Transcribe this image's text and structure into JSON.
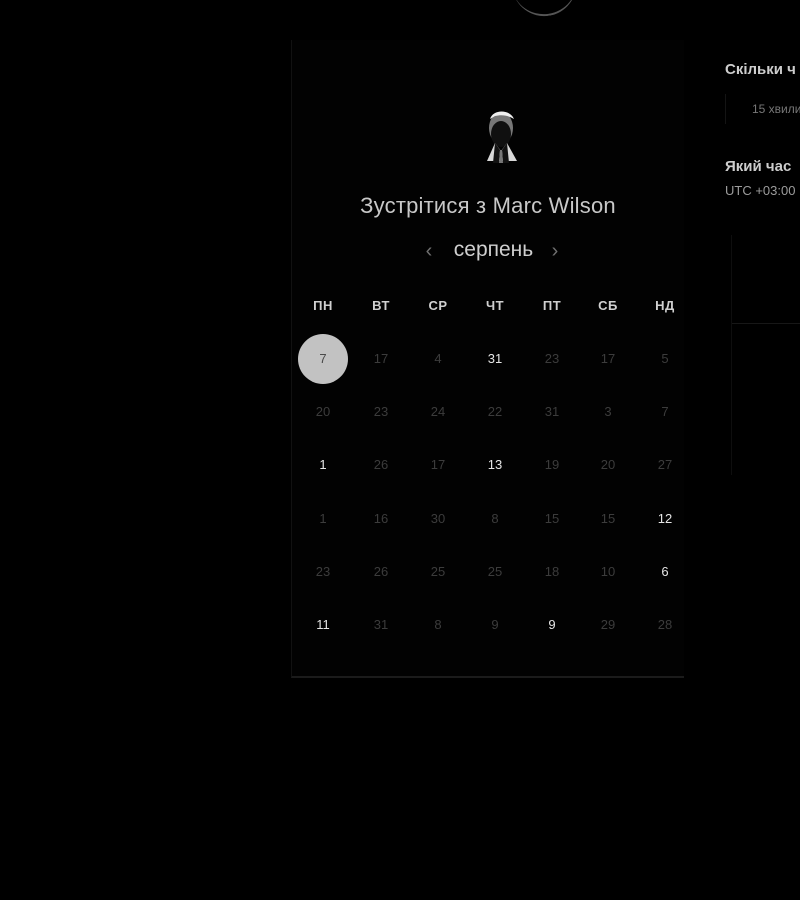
{
  "calendar": {
    "title_prefix": "Зустрітися з",
    "host_name": "Marc Wilson",
    "month": "серпень",
    "weekdays": [
      "ПН",
      "ВТ",
      "СР",
      "ЧТ",
      "ПТ",
      "СБ",
      "НД"
    ],
    "rows": [
      [
        {
          "label": "7",
          "state": "selected"
        },
        {
          "label": "17",
          "state": "muted"
        },
        {
          "label": "4",
          "state": "muted"
        },
        {
          "label": "31",
          "state": "available"
        },
        {
          "label": "23",
          "state": "muted"
        },
        {
          "label": "17",
          "state": "muted"
        },
        {
          "label": "5",
          "state": "muted"
        }
      ],
      [
        {
          "label": "20",
          "state": "muted"
        },
        {
          "label": "23",
          "state": "muted"
        },
        {
          "label": "24",
          "state": "muted"
        },
        {
          "label": "22",
          "state": "muted"
        },
        {
          "label": "31",
          "state": "muted"
        },
        {
          "label": "3",
          "state": "muted"
        },
        {
          "label": "7",
          "state": "muted"
        }
      ],
      [
        {
          "label": "1",
          "state": "available"
        },
        {
          "label": "26",
          "state": "muted"
        },
        {
          "label": "17",
          "state": "muted"
        },
        {
          "label": "13",
          "state": "available"
        },
        {
          "label": "19",
          "state": "muted"
        },
        {
          "label": "20",
          "state": "muted"
        },
        {
          "label": "27",
          "state": "muted"
        }
      ],
      [
        {
          "label": "1",
          "state": "muted"
        },
        {
          "label": "16",
          "state": "muted"
        },
        {
          "label": "30",
          "state": "muted"
        },
        {
          "label": "8",
          "state": "muted"
        },
        {
          "label": "15",
          "state": "muted"
        },
        {
          "label": "15",
          "state": "muted"
        },
        {
          "label": "12",
          "state": "available"
        }
      ],
      [
        {
          "label": "23",
          "state": "muted"
        },
        {
          "label": "26",
          "state": "muted"
        },
        {
          "label": "25",
          "state": "muted"
        },
        {
          "label": "25",
          "state": "muted"
        },
        {
          "label": "18",
          "state": "muted"
        },
        {
          "label": "10",
          "state": "muted"
        },
        {
          "label": "6",
          "state": "available"
        }
      ],
      [
        {
          "label": "11",
          "state": "available"
        },
        {
          "label": "31",
          "state": "muted"
        },
        {
          "label": "8",
          "state": "muted"
        },
        {
          "label": "9",
          "state": "muted"
        },
        {
          "label": "9",
          "state": "available"
        },
        {
          "label": "29",
          "state": "muted"
        },
        {
          "label": "28",
          "state": "muted"
        }
      ]
    ]
  },
  "right_panel": {
    "duration_heading": "Скільки ч",
    "duration_option": "15 хвили",
    "time_heading": "Який час",
    "timezone": "UTC +03:00"
  },
  "icons": {
    "previous": "chevron-left-icon",
    "next": "chevron-right-icon",
    "top_decoration": "top-shape-icon"
  },
  "colors": {
    "background": "#000000",
    "selected_day": "#c2c2c2",
    "available_day": "#e6e6e6",
    "muted_day": "#3c3c3c"
  }
}
